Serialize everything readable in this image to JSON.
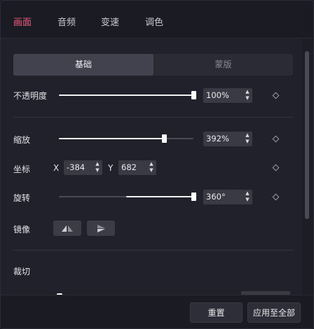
{
  "tabs": [
    "画面",
    "音频",
    "变速",
    "调色"
  ],
  "subtabs": [
    "基础",
    "蒙版"
  ],
  "opacity": {
    "label": "不透明度",
    "value": "100%",
    "level": 1.0
  },
  "scale": {
    "label": "缩放",
    "value": "392%",
    "level": 0.78
  },
  "position": {
    "label": "坐标",
    "x_label": "X",
    "x_value": "-384",
    "y_label": "Y",
    "y_value": "682"
  },
  "rotation": {
    "label": "旋转",
    "value": "360°",
    "level": 1.0
  },
  "mirror": {
    "label": "镜像"
  },
  "crop": {
    "label": "裁切"
  },
  "footer": {
    "reset": "重置",
    "apply_all": "应用至全部"
  },
  "colors": {
    "accent": "#f05d7d",
    "panel": "#21212b",
    "field": "#3a3a45"
  }
}
